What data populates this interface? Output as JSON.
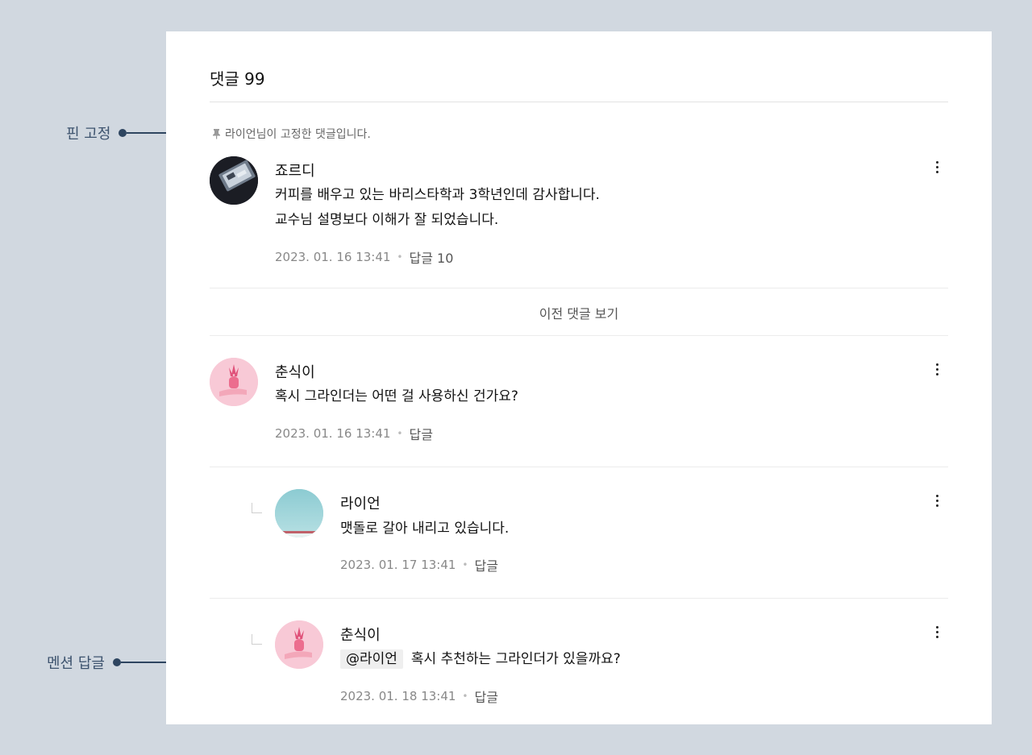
{
  "header": {
    "title": "댓글 99"
  },
  "pinned_note": "라이언님이 고정한 댓글입니다.",
  "comments": [
    {
      "author": "죠르디",
      "lines": [
        "커피를 배우고 있는 바리스타학과 3학년인데 감사합니다.",
        "교수님 설명보다 이해가 잘 되었습니다."
      ],
      "date": "2023. 01. 16 13:41",
      "reply_label": "답글 10"
    },
    {
      "author": "춘식이",
      "lines": [
        "혹시 그라인더는 어떤 걸 사용하신 건가요?"
      ],
      "date": "2023. 01. 16 13:41",
      "reply_label": "답글"
    },
    {
      "author": "라이언",
      "lines": [
        "맷돌로 갈아 내리고 있습니다."
      ],
      "date": "2023. 01. 17 13:41",
      "reply_label": "답글"
    },
    {
      "author": "춘식이",
      "mention": "@라이언",
      "lines": [
        "혹시 추천하는 그라인더가 있을까요?"
      ],
      "date": "2023. 01. 18 13:41",
      "reply_label": "답글"
    }
  ],
  "prev_comments_label": "이전 댓글 보기",
  "annotations": {
    "pin": "핀 고정",
    "mention_reply": "멘션 답글"
  },
  "icons": [
    "pin-icon",
    "more-vert-icon",
    "reply-indent-icon"
  ],
  "colors": {
    "background": "#d1d8e0",
    "panel": "#ffffff",
    "callout": "#2e4560"
  }
}
